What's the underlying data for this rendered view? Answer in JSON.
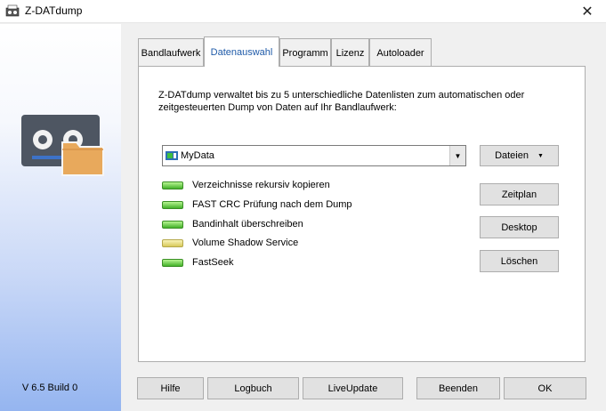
{
  "window": {
    "title": "Z-DATdump"
  },
  "sidebar": {
    "version": "V 6.5 Build 0"
  },
  "tabs": [
    "Bandlaufwerk",
    "Datenauswahl",
    "Programm",
    "Lizenz",
    "Autoloader"
  ],
  "active_tab": "Datenauswahl",
  "panel": {
    "description": "Z-DATdump verwaltet bis zu 5 unterschiedliche Datenlisten zum automatischen oder zeitgesteuerten Dump von Daten auf Ihr Bandlaufwerk:",
    "combo_value": "MyData",
    "options": [
      {
        "label": "Verzeichnisse rekursiv kopieren",
        "status": "green"
      },
      {
        "label": "FAST CRC Prüfung nach dem Dump",
        "status": "green"
      },
      {
        "label": "Bandinhalt überschreiben",
        "status": "green"
      },
      {
        "label": "Volume Shadow Service",
        "status": "yellow"
      },
      {
        "label": "FastSeek",
        "status": "green"
      }
    ],
    "buttons": {
      "dateien": "Dateien",
      "zeitplan": "Zeitplan",
      "desktop": "Desktop",
      "loeschen": "Löschen"
    }
  },
  "footer": {
    "hilfe": "Hilfe",
    "logbuch": "Logbuch",
    "liveupdate": "LiveUpdate",
    "beenden": "Beenden",
    "ok": "OK"
  },
  "colors": {
    "active_tab_text": "#1e5aa8",
    "led_green": "#44b12a",
    "led_yellow": "#d8c95a"
  }
}
